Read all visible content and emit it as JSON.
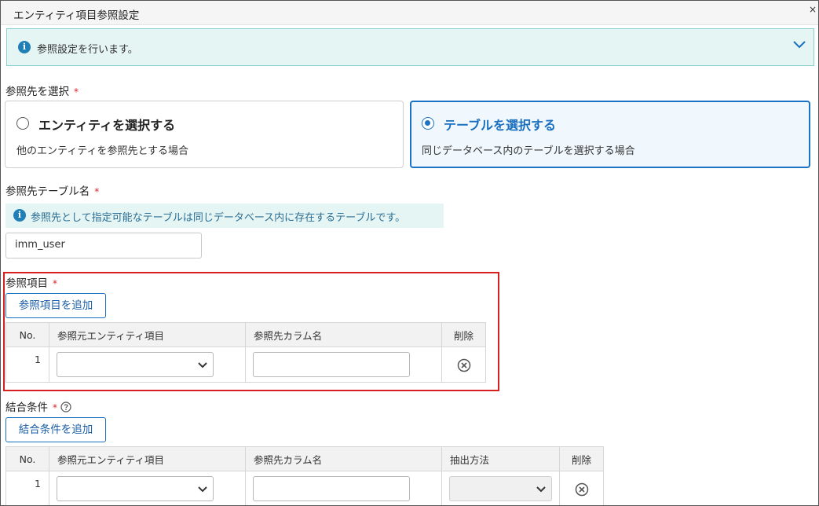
{
  "window": {
    "title": "エンティティ項目参照設定",
    "close": "×"
  },
  "banner": {
    "message": "参照設定を行います。"
  },
  "reference_target": {
    "label": "参照先を選択",
    "required_mark": "*",
    "options": [
      {
        "title": "エンティティを選択する",
        "description": "他のエンティティを参照先とする場合",
        "selected": false
      },
      {
        "title": "テーブルを選択する",
        "description": "同じデータベース内のテーブルを選択する場合",
        "selected": true
      }
    ]
  },
  "table_name": {
    "label": "参照先テーブル名",
    "required_mark": "*",
    "hint": "参照先として指定可能なテーブルは同じデータベース内に存在するテーブルです。",
    "value": "imm_user"
  },
  "reference_items": {
    "label": "参照項目",
    "required_mark": "*",
    "add_button": "参照項目を追加",
    "columns": [
      "No.",
      "参照元エンティティ項目",
      "参照先カラム名",
      "削除"
    ],
    "rows": [
      {
        "no": "1",
        "source_item": "",
        "column_name": ""
      }
    ]
  },
  "join_conditions": {
    "label": "結合条件",
    "required_mark": "*",
    "add_button": "結合条件を追加",
    "columns": [
      "No.",
      "参照元エンティティ項目",
      "参照先カラム名",
      "抽出方法",
      "削除"
    ],
    "rows": [
      {
        "no": "1",
        "source_item": "",
        "column_name": "",
        "method": ""
      }
    ]
  },
  "colors": {
    "accent": "#1a6fbf",
    "info_bg": "#e5f5f3",
    "highlight_border": "#d81f1f",
    "required": "#d9232d"
  }
}
